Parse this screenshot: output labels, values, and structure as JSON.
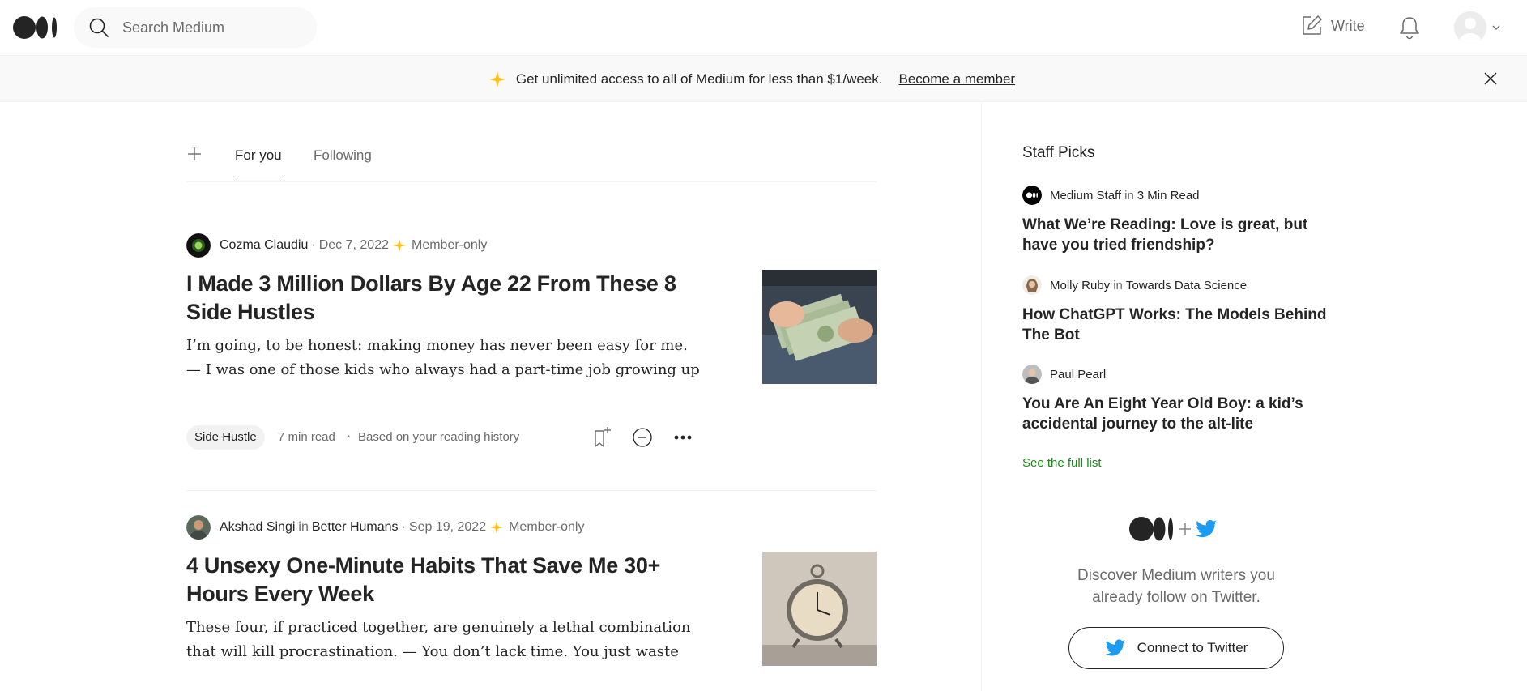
{
  "header": {
    "search_placeholder": "Search Medium",
    "write_label": "Write"
  },
  "banner": {
    "text": "Get unlimited access to all of Medium for less than $1/week.",
    "link": "Become a member"
  },
  "tabs": [
    {
      "label": "For you",
      "active": true
    },
    {
      "label": "Following",
      "active": false
    }
  ],
  "articles": [
    {
      "author": "Cozma Claudiu",
      "publication": "",
      "date": "Dec 7, 2022",
      "member_only": "Member-only",
      "title": "I Made 3 Million Dollars By Age 22 From These 8 Side Hustles",
      "excerpt": "I’m going, to be honest: making money has never been easy for me. — I was one of those kids who always had a part-time job growing up and…",
      "tag": "Side Hustle",
      "read_time": "7 min read",
      "reason": "Based on your reading history",
      "thumb_icon": "money-cash-photo"
    },
    {
      "author": "Akshad Singi",
      "in": "in",
      "publication": "Better Humans",
      "date": "Sep 19, 2022",
      "member_only": "Member-only",
      "title": "4 Unsexy One-Minute Habits That Save Me 30+ Hours Every Week",
      "excerpt": "These four, if practiced together, are genuinely a lethal combination that will kill procrastination. — You don’t lack time. You just waste m…",
      "thumb_icon": "alarm-clock-photo"
    }
  ],
  "sidebar": {
    "heading": "Staff Picks",
    "picks": [
      {
        "author": "Medium Staff",
        "in": "in",
        "publication": "3 Min Read",
        "title": "What We’re Reading: Love is great, but have you tried friendship?"
      },
      {
        "author": "Molly Ruby",
        "in": "in",
        "publication": "Towards Data Science",
        "title": "How ChatGPT Works: The Models Behind The Bot"
      },
      {
        "author": "Paul Pearl",
        "title": "You Are An Eight Year Old Boy: a kid’s accidental journey to the alt-lite"
      }
    ],
    "see_full_list": "See the full list",
    "twitter_text": "Discover Medium writers you already follow on Twitter.",
    "twitter_button": "Connect to Twitter"
  },
  "colors": {
    "accent_star": "#ffc017",
    "link_green": "#1a8917",
    "twitter_blue": "#1d9bf0"
  }
}
